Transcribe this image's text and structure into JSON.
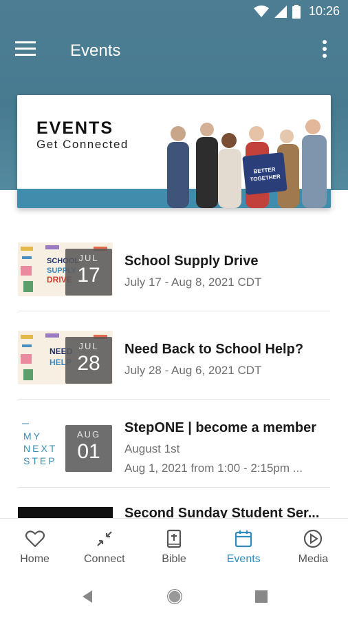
{
  "status_bar": {
    "time": "10:26"
  },
  "app_bar": {
    "title": "Events"
  },
  "banner": {
    "title": "EVENTS",
    "subtitle": "Get Connected",
    "sign_text": "BETTER TOGETHER"
  },
  "events": [
    {
      "title": "School Supply Drive",
      "subtitle": "July 17 - Aug 8, 2021 CDT",
      "subtitle2": "",
      "month": "JUL",
      "day": "17",
      "thumb_text_1": "SCHOOL",
      "thumb_text_2": "SUPPLY",
      "thumb_text_3": "DRIVE"
    },
    {
      "title": "Need Back to School Help?",
      "subtitle": "July 28 - Aug 6, 2021 CDT",
      "subtitle2": "",
      "month": "JUL",
      "day": "28",
      "thumb_text_1": "NEED",
      "thumb_text_2": "HELP"
    },
    {
      "title": "StepONE | become a member",
      "subtitle": "August 1st",
      "subtitle2": "Aug 1, 2021 from 1:00 - 2:15pm ...",
      "month": "AUG",
      "day": "01",
      "thumb_text_1": "MY",
      "thumb_text_2": "NEXT",
      "thumb_text_3": "STEP"
    },
    {
      "title": "Second Sunday Student Ser...",
      "subtitle": "",
      "subtitle2": ""
    }
  ],
  "bottom_nav": [
    {
      "label": "Home",
      "icon": "heart-icon"
    },
    {
      "label": "Connect",
      "icon": "connect-arrows-icon"
    },
    {
      "label": "Bible",
      "icon": "bible-icon"
    },
    {
      "label": "Events",
      "icon": "calendar-icon",
      "active": true
    },
    {
      "label": "Media",
      "icon": "play-circle-icon"
    }
  ],
  "colors": {
    "header": "#4d7d93",
    "accent": "#2c8cbf",
    "banner_strip": "#3f8cad"
  }
}
